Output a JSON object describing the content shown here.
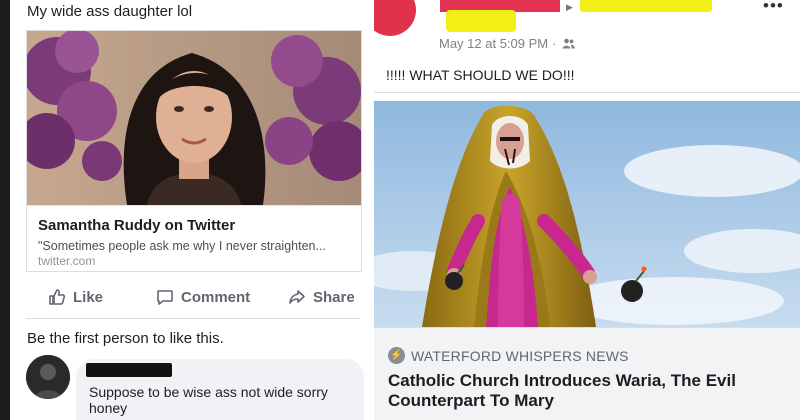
{
  "left_post": {
    "text": "My wide ass daughter lol",
    "link_card": {
      "title": "Samantha Ruddy on Twitter",
      "description": "\"Sometimes people ask me why I never straighten...",
      "domain": "twitter.com"
    },
    "actions": {
      "like": "Like",
      "comment": "Comment",
      "share": "Share"
    },
    "likes_summary": "Be the first person to like this.",
    "comment": {
      "text": "Suppose to be wise ass not wide sorry honey"
    }
  },
  "right_post": {
    "timestamp": "May 12 at 5:09 PM",
    "separator": "·",
    "privacy_icon": "friends-icon",
    "text": "!!!!! WHAT SHOULD WE DO!!!",
    "link": {
      "source": "WATERFORD WHISPERS NEWS",
      "headline": "Catholic Church Introduces Waria, The Evil Counterpart To Mary"
    },
    "more_label": "•••"
  },
  "colors": {
    "facebook_gray": "#606770",
    "redaction_red": "#e23452",
    "redaction_yellow": "#f2ef17",
    "statue_magenta": "#c8288e",
    "statue_gold": "#c8a020",
    "sky": "#a9cbe8"
  }
}
